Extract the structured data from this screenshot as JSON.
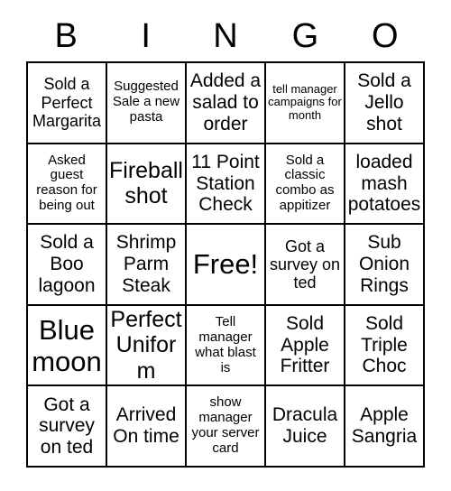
{
  "card": {
    "title": "BINGO",
    "header_letters": [
      "B",
      "I",
      "N",
      "G",
      "O"
    ],
    "columns": 5,
    "rows": 5,
    "free_space_index": 12,
    "colors": {
      "background": "#ffffff",
      "text": "#000000",
      "border": "#000000"
    },
    "cells": [
      {
        "text": "Sold a Perfect Margarita",
        "size": "md",
        "free": false
      },
      {
        "text": "Suggested Sale a new pasta",
        "size": "sm",
        "free": false
      },
      {
        "text": "Added a salad to order",
        "size": "lg",
        "free": false
      },
      {
        "text": "tell manager campaigns for month",
        "size": "xs",
        "free": false
      },
      {
        "text": "Sold a Jello shot",
        "size": "lg",
        "free": false
      },
      {
        "text": "Asked guest reason for being out",
        "size": "sm",
        "free": false
      },
      {
        "text": "Fireball shot",
        "size": "xl",
        "free": false
      },
      {
        "text": "11 Point Station Check",
        "size": "lg",
        "free": false
      },
      {
        "text": "Sold a classic combo as appitizer",
        "size": "sm",
        "free": false
      },
      {
        "text": "loaded mash potatoes",
        "size": "lg",
        "free": false
      },
      {
        "text": "Sold a Boo lagoon",
        "size": "lg",
        "free": false
      },
      {
        "text": "Shrimp Parm Steak",
        "size": "lg",
        "free": false
      },
      {
        "text": "Free!",
        "size": "xxl",
        "free": true
      },
      {
        "text": "Got a survey on ted",
        "size": "md",
        "free": false
      },
      {
        "text": "Sub Onion Rings",
        "size": "lg",
        "free": false
      },
      {
        "text": "Blue moon",
        "size": "xxl",
        "free": false
      },
      {
        "text": "Perfect Uniform",
        "size": "xl",
        "free": false
      },
      {
        "text": "Tell manager what blast is",
        "size": "sm",
        "free": false
      },
      {
        "text": "Sold Apple Fritter",
        "size": "lg",
        "free": false
      },
      {
        "text": "Sold Triple Choc",
        "size": "lg",
        "free": false
      },
      {
        "text": "Got a survey on ted",
        "size": "lg",
        "free": false
      },
      {
        "text": "Arrived On time",
        "size": "lg",
        "free": false
      },
      {
        "text": "show manager your server card",
        "size": "sm",
        "free": false
      },
      {
        "text": "Dracula Juice",
        "size": "lg",
        "free": false
      },
      {
        "text": "Apple Sangria",
        "size": "lg",
        "free": false
      }
    ]
  }
}
